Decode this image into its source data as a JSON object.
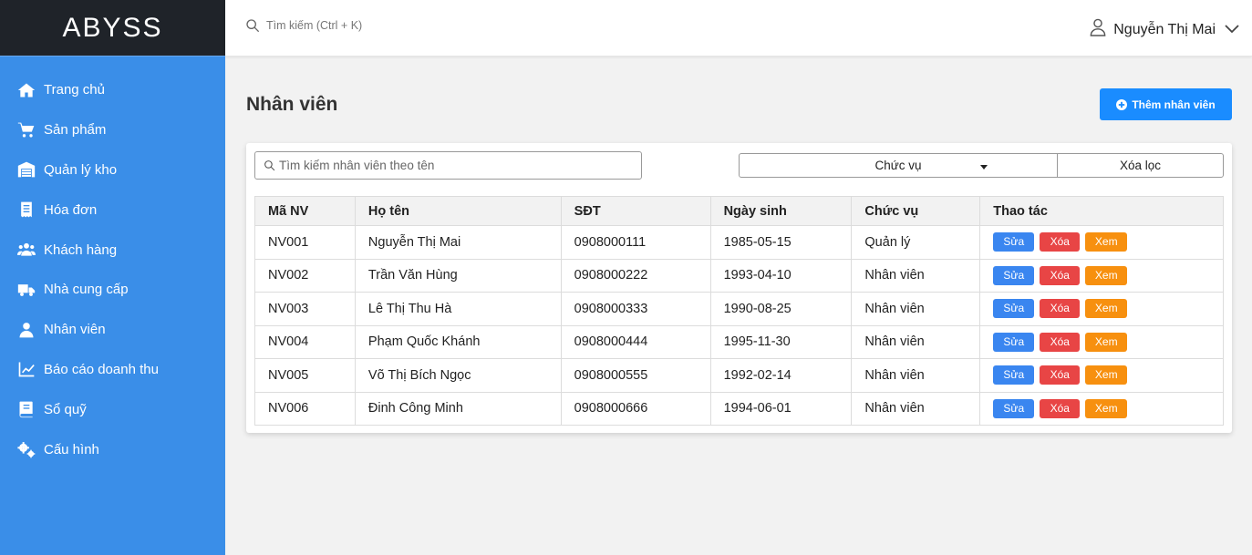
{
  "brand": {
    "logo": "ABYSS"
  },
  "sidebar": {
    "items": [
      {
        "label": "Trang chủ",
        "icon": "home-icon"
      },
      {
        "label": "Sản phẩm",
        "icon": "cart-icon"
      },
      {
        "label": "Quản lý kho",
        "icon": "warehouse-icon"
      },
      {
        "label": "Hóa đơn",
        "icon": "invoice-icon"
      },
      {
        "label": "Khách hàng",
        "icon": "users-icon"
      },
      {
        "label": "Nhà cung cấp",
        "icon": "truck-icon"
      },
      {
        "label": "Nhân viên",
        "icon": "user-icon"
      },
      {
        "label": "Báo cáo doanh thu",
        "icon": "chart-line-icon"
      },
      {
        "label": "Sổ quỹ",
        "icon": "book-icon"
      },
      {
        "label": "Cấu hình",
        "icon": "gears-icon"
      }
    ]
  },
  "header": {
    "search_placeholder": "Tìm kiếm (Ctrl + K)",
    "user_name": "Nguyễn Thị Mai"
  },
  "main": {
    "title": "Nhân viên",
    "add_button": "Thêm nhân viên",
    "search_placeholder": "Tìm kiếm nhân viên theo tên",
    "role_filter": "Chức vụ",
    "clear_filter": "Xóa lọc",
    "columns": [
      "Mã NV",
      "Họ tên",
      "SĐT",
      "Ngày sinh",
      "Chức vụ",
      "Thao tác"
    ],
    "actions": {
      "edit": "Sửa",
      "delete": "Xóa",
      "view": "Xem"
    },
    "rows": [
      [
        "NV001",
        "Nguyễn Thị Mai",
        "0908000111",
        "1985-05-15",
        "Quản lý"
      ],
      [
        "NV002",
        "Trần Văn Hùng",
        "0908000222",
        "1993-04-10",
        "Nhân viên"
      ],
      [
        "NV003",
        "Lê Thị Thu Hà",
        "0908000333",
        "1990-08-25",
        "Nhân viên"
      ],
      [
        "NV004",
        "Phạm Quốc Khánh",
        "0908000444",
        "1995-11-30",
        "Nhân viên"
      ],
      [
        "NV005",
        "Võ Thị Bích Ngọc",
        "0908000555",
        "1992-02-14",
        "Nhân viên"
      ],
      [
        "NV006",
        "Đinh Công Minh",
        "0908000666",
        "1994-06-01",
        "Nhân viên"
      ]
    ]
  },
  "colors": {
    "sidebar": "#3a8ee8",
    "logo_bg": "#1f2329",
    "primary": "#1a8cff",
    "edit": "#3a86f0",
    "delete": "#e84545",
    "view": "#f7900f"
  }
}
